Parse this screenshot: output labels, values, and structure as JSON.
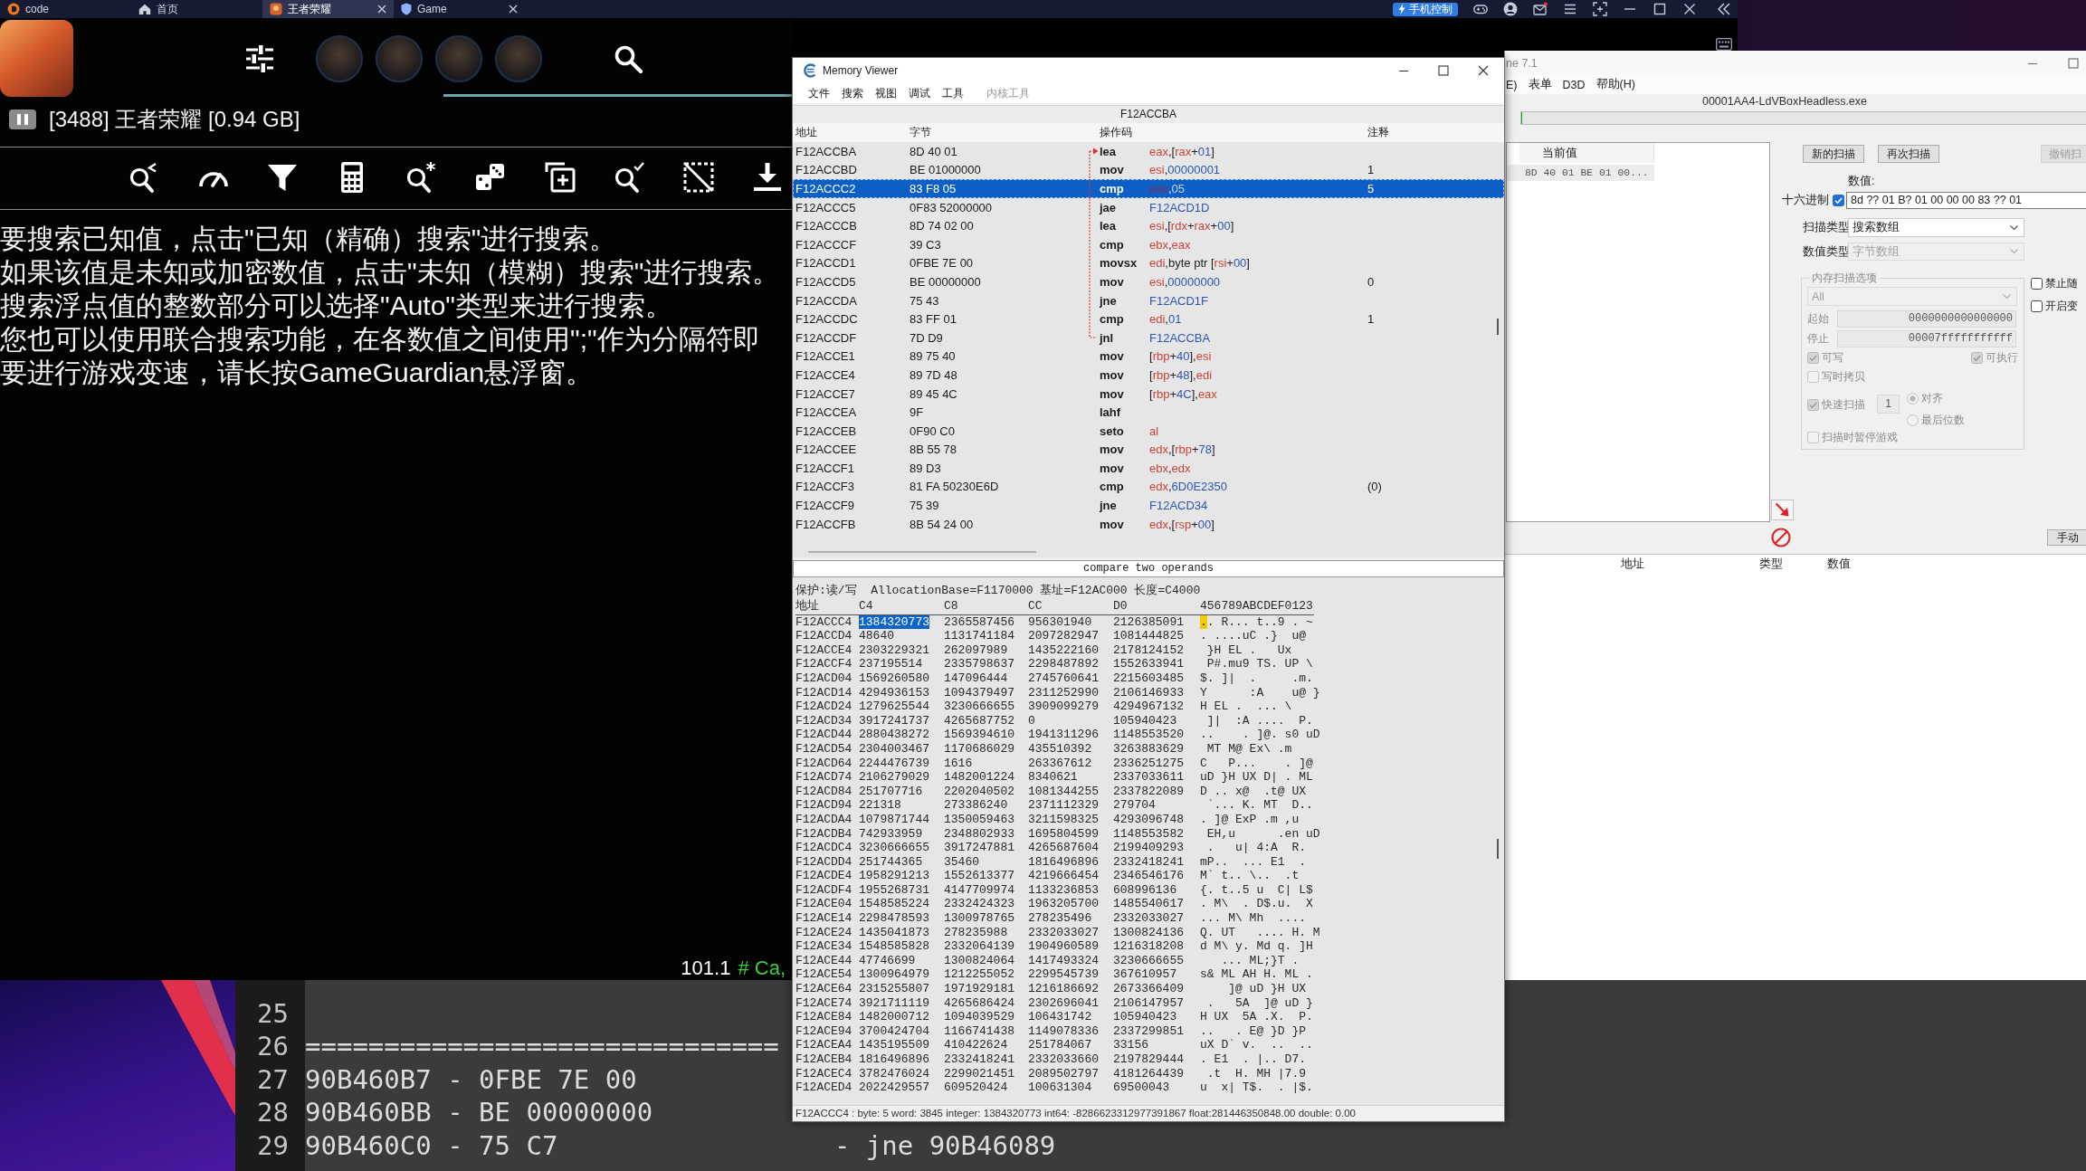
{
  "emulator": {
    "tabs": [
      {
        "label": "code",
        "closable": false,
        "selected": false
      },
      {
        "label": "首页",
        "closable": false,
        "selected": false
      },
      {
        "label": "王者荣耀",
        "closable": true,
        "selected": true
      },
      {
        "label": "Game",
        "closable": true,
        "selected": false
      }
    ],
    "phone_control": "手机控制"
  },
  "gameguardian": {
    "process": "[3488] 王者荣耀 [0.94 GB]",
    "help_lines": [
      "要搜索已知值，点击\"已知（精确）搜索\"进行搜索。",
      "如果该值是未知或加密数值，点击\"未知（模糊）搜索\"进行搜索。",
      "搜索浮点值的整数部分可以选择\"Auto\"类型来进行搜索。",
      "您也可以使用联合搜索功能，在各数值之间使用\";\"作为分隔符即",
      "要进行游戏变速，请长按GameGuardian悬浮窗。"
    ],
    "status": {
      "value": "101.1",
      "note": "# Ca,"
    }
  },
  "memory_viewer": {
    "title": "Memory Viewer",
    "menu": [
      {
        "label": "文件",
        "disabled": false
      },
      {
        "label": "搜索",
        "disabled": false
      },
      {
        "label": "视图",
        "disabled": false
      },
      {
        "label": "调试",
        "disabled": false
      },
      {
        "label": "工具",
        "disabled": false
      },
      {
        "label": "内核工具",
        "disabled": true
      }
    ],
    "address": "F12ACCBA",
    "columns": [
      "地址",
      "字节",
      "操作码",
      "注释"
    ],
    "rows": [
      {
        "address": "F12ACCBA",
        "bytes": "8D 40 01",
        "opcode": "lea",
        "operand": [
          {
            "kind": "reg",
            "text": "eax"
          },
          {
            "kind": "sym",
            "text": ",["
          },
          {
            "kind": "reg",
            "text": "rax"
          },
          {
            "kind": "sym",
            "text": "+"
          },
          {
            "kind": "num",
            "text": "01"
          },
          {
            "kind": "sym",
            "text": "]"
          }
        ],
        "selected": false,
        "jump_target": true
      },
      {
        "address": "F12ACCBD",
        "bytes": "BE 01000000",
        "opcode": "mov",
        "operand": [
          {
            "kind": "reg",
            "text": "esi"
          },
          {
            "kind": "sym",
            "text": ","
          },
          {
            "kind": "num",
            "text": "00000001"
          }
        ],
        "comment": "1",
        "selected": false
      },
      {
        "address": "F12ACCC2",
        "bytes": "83 F8 05",
        "opcode": "cmp",
        "operand": [
          {
            "kind": "reg",
            "text": "eax"
          },
          {
            "kind": "sym",
            "text": ","
          },
          {
            "kind": "num",
            "text": "05"
          }
        ],
        "comment": "5",
        "selected": true
      },
      {
        "address": "F12ACCC5",
        "bytes": "0F83 52000000",
        "opcode": "jae",
        "operand": [
          {
            "kind": "num",
            "text": "F12ACD1D"
          }
        ],
        "selected": false
      },
      {
        "address": "F12ACCCB",
        "bytes": "8D 74 02 00",
        "opcode": "lea",
        "operand": [
          {
            "kind": "reg",
            "text": "esi"
          },
          {
            "kind": "sym",
            "text": ",["
          },
          {
            "kind": "reg",
            "text": "rdx"
          },
          {
            "kind": "sym",
            "text": "+"
          },
          {
            "kind": "reg",
            "text": "rax"
          },
          {
            "kind": "sym",
            "text": "+"
          },
          {
            "kind": "num",
            "text": "00"
          },
          {
            "kind": "sym",
            "text": "]"
          }
        ],
        "selected": false
      },
      {
        "address": "F12ACCCF",
        "bytes": "39 C3",
        "opcode": "cmp",
        "operand": [
          {
            "kind": "reg",
            "text": "ebx"
          },
          {
            "kind": "sym",
            "text": ","
          },
          {
            "kind": "reg",
            "text": "eax"
          }
        ],
        "selected": false
      },
      {
        "address": "F12ACCD1",
        "bytes": "0FBE 7E 00",
        "opcode": "movsx",
        "operand": [
          {
            "kind": "reg",
            "text": "edi"
          },
          {
            "kind": "sym",
            "text": ",byte ptr ["
          },
          {
            "kind": "reg",
            "text": "rsi"
          },
          {
            "kind": "sym",
            "text": "+"
          },
          {
            "kind": "num",
            "text": "00"
          },
          {
            "kind": "sym",
            "text": "]"
          }
        ],
        "selected": false
      },
      {
        "address": "F12ACCD5",
        "bytes": "BE 00000000",
        "opcode": "mov",
        "operand": [
          {
            "kind": "reg",
            "text": "esi"
          },
          {
            "kind": "sym",
            "text": ","
          },
          {
            "kind": "num",
            "text": "00000000"
          }
        ],
        "comment": "0",
        "selected": false
      },
      {
        "address": "F12ACCDA",
        "bytes": "75 43",
        "opcode": "jne",
        "operand": [
          {
            "kind": "num",
            "text": "F12ACD1F"
          }
        ],
        "selected": false
      },
      {
        "address": "F12ACCDC",
        "bytes": "83 FF 01",
        "opcode": "cmp",
        "operand": [
          {
            "kind": "reg",
            "text": "edi"
          },
          {
            "kind": "sym",
            "text": ","
          },
          {
            "kind": "num",
            "text": "01"
          }
        ],
        "comment": "1",
        "selected": false
      },
      {
        "address": "F12ACCDF",
        "bytes": "7D D9",
        "opcode": "jnl",
        "operand": [
          {
            "kind": "num",
            "text": "F12ACCBA"
          }
        ],
        "selected": false,
        "jump_source": true
      },
      {
        "address": "F12ACCE1",
        "bytes": "89 75 40",
        "opcode": "mov",
        "operand": [
          {
            "kind": "sym",
            "text": "["
          },
          {
            "kind": "reg",
            "text": "rbp"
          },
          {
            "kind": "sym",
            "text": "+"
          },
          {
            "kind": "num",
            "text": "40"
          },
          {
            "kind": "sym",
            "text": "],"
          },
          {
            "kind": "reg",
            "text": "esi"
          }
        ],
        "selected": false
      },
      {
        "address": "F12ACCE4",
        "bytes": "89 7D 48",
        "opcode": "mov",
        "operand": [
          {
            "kind": "sym",
            "text": "["
          },
          {
            "kind": "reg",
            "text": "rbp"
          },
          {
            "kind": "sym",
            "text": "+"
          },
          {
            "kind": "num",
            "text": "48"
          },
          {
            "kind": "sym",
            "text": "],"
          },
          {
            "kind": "reg",
            "text": "edi"
          }
        ],
        "selected": false
      },
      {
        "address": "F12ACCE7",
        "bytes": "89 45 4C",
        "opcode": "mov",
        "operand": [
          {
            "kind": "sym",
            "text": "["
          },
          {
            "kind": "reg",
            "text": "rbp"
          },
          {
            "kind": "sym",
            "text": "+"
          },
          {
            "kind": "num",
            "text": "4C"
          },
          {
            "kind": "sym",
            "text": "],"
          },
          {
            "kind": "reg",
            "text": "eax"
          }
        ],
        "selected": false
      },
      {
        "address": "F12ACCEA",
        "bytes": "9F",
        "opcode": "lahf",
        "selected": false
      },
      {
        "address": "F12ACCEB",
        "bytes": "0F90 C0",
        "opcode": "seto",
        "operand": [
          {
            "kind": "reg",
            "text": "al"
          }
        ],
        "selected": false
      },
      {
        "address": "F12ACCEE",
        "bytes": "8B 55 78",
        "opcode": "mov",
        "operand": [
          {
            "kind": "reg",
            "text": "edx"
          },
          {
            "kind": "sym",
            "text": ",["
          },
          {
            "kind": "reg",
            "text": "rbp"
          },
          {
            "kind": "sym",
            "text": "+"
          },
          {
            "kind": "num",
            "text": "78"
          },
          {
            "kind": "sym",
            "text": "]"
          }
        ],
        "selected": false
      },
      {
        "address": "F12ACCF1",
        "bytes": "89 D3",
        "opcode": "mov",
        "operand": [
          {
            "kind": "reg",
            "text": "ebx"
          },
          {
            "kind": "sym",
            "text": ","
          },
          {
            "kind": "reg",
            "text": "edx"
          }
        ],
        "selected": false
      },
      {
        "address": "F12ACCF3",
        "bytes": "81 FA 50230E6D",
        "opcode": "cmp",
        "operand": [
          {
            "kind": "reg",
            "text": "edx"
          },
          {
            "kind": "sym",
            "text": ","
          },
          {
            "kind": "num",
            "text": "6D0E2350"
          }
        ],
        "comment": "(0)",
        "selected": false
      },
      {
        "address": "F12ACCF9",
        "bytes": "75 39",
        "opcode": "jne",
        "operand": [
          {
            "kind": "num",
            "text": "F12ACD34"
          }
        ],
        "selected": false
      },
      {
        "address": "F12ACCFB",
        "bytes": "8B 54 24 00",
        "opcode": "mov",
        "operand": [
          {
            "kind": "reg",
            "text": "edx"
          },
          {
            "kind": "sym",
            "text": ",["
          },
          {
            "kind": "reg",
            "text": "rsp"
          },
          {
            "kind": "sym",
            "text": "+"
          },
          {
            "kind": "num",
            "text": "00"
          },
          {
            "kind": "sym",
            "text": "]"
          }
        ],
        "selected": false
      }
    ],
    "description": "compare two operands",
    "hex_info": "保护:读/写  AllocationBase=F1170000 基址=F12AC000 长度=C4000",
    "hex_columns": [
      "地址",
      "C4",
      "C8",
      "CC",
      "D0",
      "456789ABCDEF0123"
    ],
    "hex_rows": [
      {
        "address": "F12ACCC4",
        "values": [
          "1384320773",
          "2365587456",
          "956301940",
          "2126385091"
        ],
        "ascii": ".. R... t..9 . ~",
        "selected": true
      },
      {
        "address": "F12ACCD4",
        "values": [
          "48640",
          "1131741184",
          "2097282947",
          "1081444825"
        ],
        "ascii": ". ....uC .}  u@",
        "selected": false
      },
      {
        "address": "F12ACCE4",
        "values": [
          "2303229321",
          "262097989",
          "1435222160",
          "2178124152"
        ],
        "ascii": " }H EL .   Ux",
        "selected": false
      },
      {
        "address": "F12ACCF4",
        "values": [
          "237195514",
          "2335798637",
          "2298487892",
          "1552633941"
        ],
        "ascii": " P#.mu9 TS. UP \\",
        "selected": false
      },
      {
        "address": "F12ACD04",
        "values": [
          "1569260580",
          "147096444",
          "2745760641",
          "2215603485"
        ],
        "ascii": "$. ]|  .     .m.",
        "selected": false
      },
      {
        "address": "F12ACD14",
        "values": [
          "4294936153",
          "1094379497",
          "2311252990",
          "2106146933"
        ],
        "ascii": "Y      :A    u@ }",
        "selected": false
      },
      {
        "address": "F12ACD24",
        "values": [
          "1279625544",
          "3230666655",
          "3909099279",
          "4294967132"
        ],
        "ascii": "H EL .  ... \\",
        "selected": false
      },
      {
        "address": "F12ACD34",
        "values": [
          "3917241737",
          "4265687752",
          "0",
          "105940423"
        ],
        "ascii": " ]|  :A ....  P.",
        "selected": false
      },
      {
        "address": "F12ACD44",
        "values": [
          "2880438272",
          "1569394610",
          "1941311296",
          "1148553520"
        ],
        "ascii": "..    . ]@. s0 uD",
        "selected": false
      },
      {
        "address": "F12ACD54",
        "values": [
          "2304003467",
          "1170686029",
          "435510392",
          "3263883629"
        ],
        "ascii": " MT M@ Ex\\ .m",
        "selected": false
      },
      {
        "address": "F12ACD64",
        "values": [
          "2244476739",
          "1616",
          "263367612",
          "2336251275"
        ],
        "ascii": "C   P...    . ]@",
        "selected": false
      },
      {
        "address": "F12ACD74",
        "values": [
          "2106279029",
          "1482001224",
          "8340621",
          "2337033611"
        ],
        "ascii": "uD }H UX D| . ML",
        "selected": false
      },
      {
        "address": "F12ACD84",
        "values": [
          "251707716",
          "2202040502",
          "1081344255",
          "2337822089"
        ],
        "ascii": "D .. x@  .t@ UX",
        "selected": false
      },
      {
        "address": "F12ACD94",
        "values": [
          "221318",
          "273386240",
          "2371112329",
          "279704"
        ],
        "ascii": " `... K. MT  D..",
        "selected": false
      },
      {
        "address": "F12ACDA4",
        "values": [
          "1079871744",
          "1350059463",
          "3211598325",
          "4293096748"
        ],
        "ascii": ". ]@ ExP .m ,u",
        "selected": false
      },
      {
        "address": "F12ACDB4",
        "values": [
          "742933959",
          "2348802933",
          "1695804599",
          "1148553582"
        ],
        "ascii": " EH,u      .en uD",
        "selected": false
      },
      {
        "address": "F12ACDC4",
        "values": [
          "3230666655",
          "3917247881",
          "4265687604",
          "2199409293"
        ],
        "ascii": " .   u| 4:A  R.",
        "selected": false
      },
      {
        "address": "F12ACDD4",
        "values": [
          "251744365",
          "35460",
          "1816496896",
          "2332418241"
        ],
        "ascii": "mP..  ... E1  .",
        "selected": false
      },
      {
        "address": "F12ACDE4",
        "values": [
          "1958291213",
          "1552613377",
          "4219666454",
          "2346546176"
        ],
        "ascii": "M` t.. \\..  .t",
        "selected": false
      },
      {
        "address": "F12ACDF4",
        "values": [
          "1955268731",
          "4147709974",
          "1133236853",
          "608996136"
        ],
        "ascii": "{. t..5 u  C| L$",
        "selected": false
      },
      {
        "address": "F12ACE04",
        "values": [
          "1548585224",
          "2332424323",
          "1963205700",
          "1485540617"
        ],
        "ascii": ". M\\  . D$.u.  X",
        "selected": false
      },
      {
        "address": "F12ACE14",
        "values": [
          "2298478593",
          "1300978765",
          "278235496",
          "2332033027"
        ],
        "ascii": "... M\\ Mh  ....",
        "selected": false
      },
      {
        "address": "F12ACE24",
        "values": [
          "1435041873",
          "278235988",
          "2332033027",
          "1300824136"
        ],
        "ascii": "Q. UT   .... H. M",
        "selected": false
      },
      {
        "address": "F12ACE34",
        "values": [
          "1548585828",
          "2332064139",
          "1904960589",
          "1216318208"
        ],
        "ascii": "d M\\ y. Md q. ]H",
        "selected": false
      },
      {
        "address": "F12ACE44",
        "values": [
          "47746699",
          "1300824064",
          "1417493324",
          "3230666655"
        ],
        "ascii": "   ... ML;}T .",
        "selected": false
      },
      {
        "address": "F12ACE54",
        "values": [
          "1300964979",
          "1212255052",
          "2299545739",
          "367610957"
        ],
        "ascii": "s& ML AH H. ML .",
        "selected": false
      },
      {
        "address": "F12ACE64",
        "values": [
          "2315255807",
          "1971929181",
          "1216186692",
          "2673366409"
        ],
        "ascii": "    ]@ uD }H UX",
        "selected": false
      },
      {
        "address": "F12ACE74",
        "values": [
          "3921711119",
          "4265686424",
          "2302696041",
          "2106147957"
        ],
        "ascii": " .   5A  ]@ uD }",
        "selected": false
      },
      {
        "address": "F12ACE84",
        "values": [
          "1482000712",
          "1094039529",
          "106431742",
          "105940423"
        ],
        "ascii": "H UX  5A .X.  P.",
        "selected": false
      },
      {
        "address": "F12ACE94",
        "values": [
          "3700424704",
          "1166741438",
          "1149078336",
          "2337299851"
        ],
        "ascii": "..   . E@ }D }P",
        "selected": false
      },
      {
        "address": "F12ACEA4",
        "values": [
          "1435195509",
          "410422624",
          "251784067",
          "33156"
        ],
        "ascii": "uX D` v.  ..  ..",
        "selected": false
      },
      {
        "address": "F12ACEB4",
        "values": [
          "1816496896",
          "2332418241",
          "2332033660",
          "2197829444"
        ],
        "ascii": ". E1  . |.. D7.",
        "selected": false
      },
      {
        "address": "F12ACEC4",
        "values": [
          "3782476024",
          "2299021451",
          "2089502797",
          "4181264439"
        ],
        "ascii": " .t  H. MH |7.9",
        "selected": false
      },
      {
        "address": "F12ACED4",
        "values": [
          "2022429557",
          "609520424",
          "100631304",
          "69500043"
        ],
        "ascii": "u  x| T$.  . |$.",
        "selected": false
      }
    ],
    "status": "F12ACCC4 : byte: 5 word: 3845 integer: 1384320773 int64: -8286623312977391867 float:281446350848.00 double: 0.00"
  },
  "cheat_engine": {
    "title": "ne 7.1",
    "menu": [
      "E)",
      "表单",
      "D3D",
      "帮助(H)"
    ],
    "process": "00001AA4-LdVBoxHeadless.exe",
    "scan_progress": {
      "level": 0
    },
    "results": {
      "column": "当前值",
      "values": [
        "8D 40 01 BE 01 00..."
      ]
    },
    "scan_buttons": [
      {
        "label": "新的扫描",
        "disabled": false
      },
      {
        "label": "再次扫描",
        "disabled": false
      },
      {
        "label": "撤销扫",
        "disabled": true
      }
    ],
    "value_label": "数值:",
    "hex_input": {
      "label": "十六进制",
      "checked": true,
      "value": "8d ?? 01 B? 01 00 00 00 83 ?? 01"
    },
    "scan_type": {
      "label": "扫描类型",
      "value": "搜索数组",
      "disabled": false
    },
    "value_type": {
      "label": "数值类型",
      "value": "字节数组",
      "disabled": true
    },
    "memory_options": {
      "title": "内存扫描选项",
      "disabled": true,
      "region": "All",
      "start": {
        "label": "起始",
        "value": "0000000000000000"
      },
      "stop": {
        "label": "停止",
        "value": "00007fffffffffff"
      },
      "writable": {
        "label": "可写",
        "checked": true
      },
      "executable": {
        "label": "可执行",
        "checked": true
      },
      "copy_on_write": {
        "label": "写时拷贝",
        "checked": false
      },
      "fast_scan": {
        "label": "快速扫描",
        "checked": true,
        "value": "1"
      },
      "alignment": [
        {
          "label": "对齐",
          "selected": true
        },
        {
          "label": "最后位数",
          "selected": false
        }
      ],
      "pause_game": {
        "label": "扫描时暂停游戏",
        "checked": false
      }
    },
    "side_options": [
      {
        "label": "禁止随",
        "checked": false
      },
      {
        "label": "开启变",
        "checked": false
      }
    ],
    "add_button": "手动",
    "address_columns": [
      "地址",
      "类型",
      "数值"
    ]
  },
  "code_editor": {
    "lines": [
      {
        "number": "25"
      },
      {
        "number": "26",
        "code": "=============================="
      },
      {
        "number": "27",
        "code": "90B460B7 - 0FBE 7E 00"
      },
      {
        "number": "28",
        "code": "90B460BB - BE 00000000"
      },
      {
        "number": "29",
        "code": "90B460C0 - 75 C7",
        "comment": "- jne 90B46089"
      }
    ]
  }
}
